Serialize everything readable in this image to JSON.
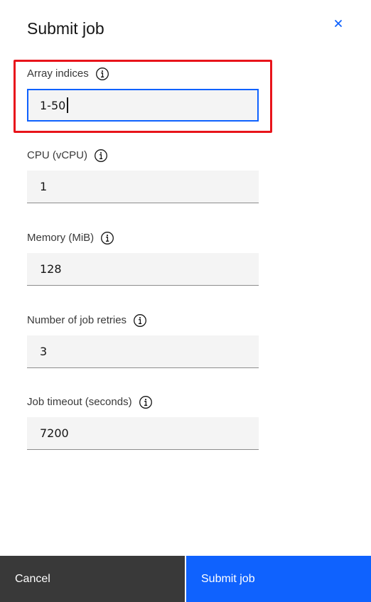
{
  "modal": {
    "title": "Submit job",
    "close_icon": "close-icon"
  },
  "fields": [
    {
      "label": "Array indices",
      "value": "1-50",
      "focused": true,
      "info_icon": "information-icon"
    },
    {
      "label": "CPU (vCPU)",
      "value": "1",
      "focused": false,
      "info_icon": "information-icon"
    },
    {
      "label": "Memory (MiB)",
      "value": "128",
      "focused": false,
      "info_icon": "information-icon"
    },
    {
      "label": "Number of job retries",
      "value": "3",
      "focused": false,
      "info_icon": "information-icon"
    },
    {
      "label": "Job timeout (seconds)",
      "value": "7200",
      "focused": false,
      "info_icon": "information-icon"
    }
  ],
  "footer": {
    "cancel_label": "Cancel",
    "submit_label": "Submit job"
  },
  "colors": {
    "primary": "#0f62fe",
    "secondary": "#393939",
    "highlight": "#e8141b",
    "field_bg": "#f4f4f4"
  }
}
